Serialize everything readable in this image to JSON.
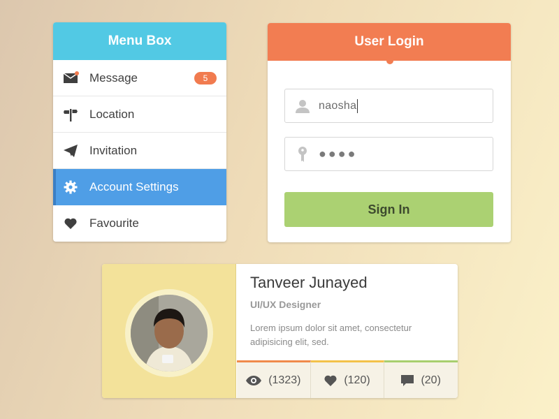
{
  "menu": {
    "title": "Menu Box",
    "items": [
      {
        "label": "Message",
        "icon": "envelope-icon",
        "badge": "5"
      },
      {
        "label": "Location",
        "icon": "signpost-icon"
      },
      {
        "label": "Invitation",
        "icon": "paper-plane-icon"
      },
      {
        "label": "Account Settings",
        "icon": "gear-icon",
        "active": true
      },
      {
        "label": "Favourite",
        "icon": "heart-icon"
      }
    ],
    "header_color": "#52c9e4",
    "active_color": "#4f9ee6",
    "badge_color": "#f17b4f"
  },
  "login": {
    "title": "User Login",
    "username_value": "naosha",
    "password_mask": "●●●●",
    "signin_label": "Sign In",
    "header_color": "#f27d52",
    "button_color": "#abd172"
  },
  "profile": {
    "name": "Tanveer Junayed",
    "role": "UI/UX Designer",
    "description": "Lorem ipsum dolor sit amet, consectetur adipisicing elit, sed.",
    "stats": [
      {
        "icon": "eye-icon",
        "value": "(1323)",
        "color": "#f08a4b"
      },
      {
        "icon": "heart-icon",
        "value": "(120)",
        "color": "#f3c24a"
      },
      {
        "icon": "comment-icon",
        "value": "(20)",
        "color": "#a8cf6e"
      }
    ]
  }
}
